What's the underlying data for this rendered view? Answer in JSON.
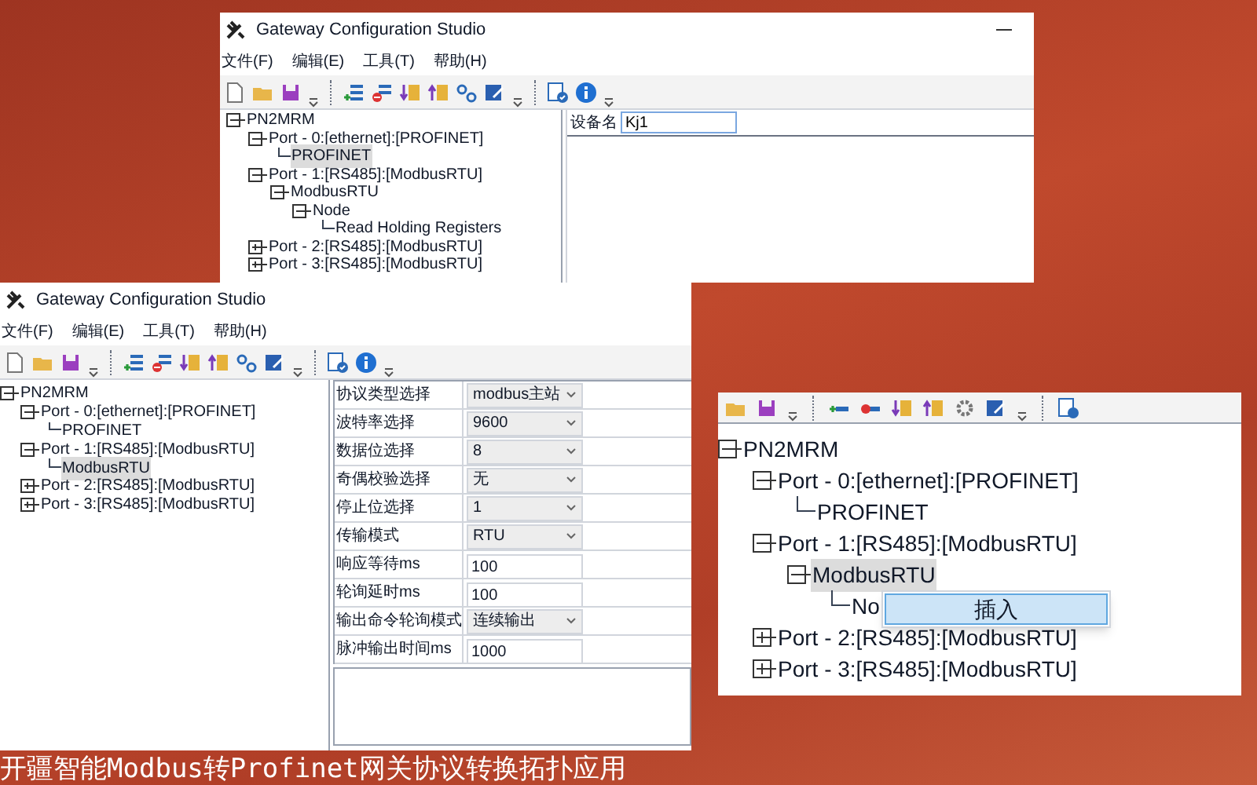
{
  "windows": [
    {
      "title": "Gateway Configuration Studio",
      "menu": [
        "文件(F)",
        "编辑(E)",
        "工具(T)",
        "帮助(H)"
      ],
      "tree": [
        {
          "label": "PN2MRM",
          "expanded": true,
          "selected": false,
          "children": [
            {
              "label": "Port - 0:[ethernet]:[PROFINET]",
              "expanded": true,
              "selected": false,
              "children": [
                {
                  "label": "PROFINET",
                  "selected": true
                }
              ]
            },
            {
              "label": "Port - 1:[RS485]:[ModbusRTU]",
              "expanded": true,
              "selected": false,
              "children": [
                {
                  "label": "ModbusRTU",
                  "expanded": true,
                  "selected": false,
                  "children": [
                    {
                      "label": "Node",
                      "expanded": true,
                      "selected": false,
                      "children": [
                        {
                          "label": "Read Holding Registers",
                          "selected": false
                        }
                      ]
                    }
                  ]
                }
              ]
            },
            {
              "label": "Port - 2:[RS485]:[ModbusRTU]",
              "expanded": false,
              "selected": false
            },
            {
              "label": "Port - 3:[RS485]:[ModbusRTU]",
              "expanded": false,
              "selected": false
            }
          ]
        }
      ],
      "device_name": {
        "label": "设备名",
        "value": "Kj1"
      }
    },
    {
      "title": "Gateway Configuration Studio",
      "menu": [
        "文件(F)",
        "编辑(E)",
        "工具(T)",
        "帮助(H)"
      ],
      "tree": [
        {
          "label": "PN2MRM",
          "expanded": true,
          "selected": false,
          "children": [
            {
              "label": "Port - 0:[ethernet]:[PROFINET]",
              "expanded": true,
              "selected": false,
              "children": [
                {
                  "label": "PROFINET",
                  "selected": false
                }
              ]
            },
            {
              "label": "Port - 1:[RS485]:[ModbusRTU]",
              "expanded": true,
              "selected": false,
              "children": [
                {
                  "label": "ModbusRTU",
                  "selected": true
                }
              ]
            },
            {
              "label": "Port - 2:[RS485]:[ModbusRTU]",
              "expanded": false,
              "selected": false
            },
            {
              "label": "Port - 3:[RS485]:[ModbusRTU]",
              "expanded": false,
              "selected": false
            }
          ]
        }
      ],
      "properties": [
        {
          "label": "协议类型选择",
          "value": "modbus主站",
          "kind": "dropdown"
        },
        {
          "label": "波特率选择",
          "value": "9600",
          "kind": "dropdown"
        },
        {
          "label": "数据位选择",
          "value": "8",
          "kind": "dropdown"
        },
        {
          "label": "奇偶校验选择",
          "value": "无",
          "kind": "dropdown"
        },
        {
          "label": "停止位选择",
          "value": "1",
          "kind": "dropdown"
        },
        {
          "label": "传输模式",
          "value": "RTU",
          "kind": "dropdown"
        },
        {
          "label": "响应等待ms",
          "value": "100",
          "kind": "text"
        },
        {
          "label": "轮询延时ms",
          "value": "100",
          "kind": "text"
        },
        {
          "label": "输出命令轮询模式",
          "value": "连续输出",
          "kind": "dropdown"
        },
        {
          "label": "脉冲输出时间ms",
          "value": "1000",
          "kind": "text"
        }
      ]
    }
  ],
  "zoom_inset": {
    "tree": [
      {
        "label": "PN2MRM",
        "expanded": true,
        "selected": false,
        "children": [
          {
            "label": "Port - 0:[ethernet]:[PROFINET]",
            "expanded": true,
            "selected": false,
            "children": [
              {
                "label": "PROFINET",
                "selected": false
              }
            ]
          },
          {
            "label": "Port - 1:[RS485]:[ModbusRTU]",
            "expanded": true,
            "selected": false,
            "children": [
              {
                "label": "ModbusRTU",
                "expanded": true,
                "selected": true,
                "children": [
                  {
                    "label": "No",
                    "selected": false
                  }
                ]
              }
            ]
          },
          {
            "label": "Port - 2:[RS485]:[ModbusRTU]",
            "expanded": false,
            "selected": false
          },
          {
            "label": "Port - 3:[RS485]:[ModbusRTU]",
            "expanded": false,
            "selected": false
          }
        ]
      }
    ],
    "context_menu": [
      "插入"
    ]
  },
  "caption": "开疆智能Modbus转Profinet网关协议转换拓扑应用"
}
